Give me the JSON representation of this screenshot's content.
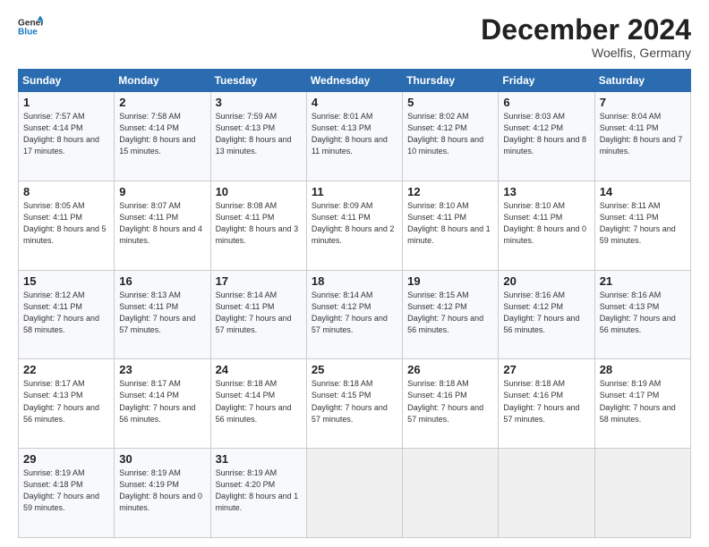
{
  "header": {
    "logo_line1": "General",
    "logo_line2": "Blue",
    "month_title": "December 2024",
    "location": "Woelfis, Germany"
  },
  "days_of_week": [
    "Sunday",
    "Monday",
    "Tuesday",
    "Wednesday",
    "Thursday",
    "Friday",
    "Saturday"
  ],
  "weeks": [
    [
      {
        "num": "1",
        "rise": "7:57 AM",
        "set": "4:14 PM",
        "daylight": "8 hours and 17 minutes."
      },
      {
        "num": "2",
        "rise": "7:58 AM",
        "set": "4:14 PM",
        "daylight": "8 hours and 15 minutes."
      },
      {
        "num": "3",
        "rise": "7:59 AM",
        "set": "4:13 PM",
        "daylight": "8 hours and 13 minutes."
      },
      {
        "num": "4",
        "rise": "8:01 AM",
        "set": "4:13 PM",
        "daylight": "8 hours and 11 minutes."
      },
      {
        "num": "5",
        "rise": "8:02 AM",
        "set": "4:12 PM",
        "daylight": "8 hours and 10 minutes."
      },
      {
        "num": "6",
        "rise": "8:03 AM",
        "set": "4:12 PM",
        "daylight": "8 hours and 8 minutes."
      },
      {
        "num": "7",
        "rise": "8:04 AM",
        "set": "4:11 PM",
        "daylight": "8 hours and 7 minutes."
      }
    ],
    [
      {
        "num": "8",
        "rise": "8:05 AM",
        "set": "4:11 PM",
        "daylight": "8 hours and 5 minutes."
      },
      {
        "num": "9",
        "rise": "8:07 AM",
        "set": "4:11 PM",
        "daylight": "8 hours and 4 minutes."
      },
      {
        "num": "10",
        "rise": "8:08 AM",
        "set": "4:11 PM",
        "daylight": "8 hours and 3 minutes."
      },
      {
        "num": "11",
        "rise": "8:09 AM",
        "set": "4:11 PM",
        "daylight": "8 hours and 2 minutes."
      },
      {
        "num": "12",
        "rise": "8:10 AM",
        "set": "4:11 PM",
        "daylight": "8 hours and 1 minute."
      },
      {
        "num": "13",
        "rise": "8:10 AM",
        "set": "4:11 PM",
        "daylight": "8 hours and 0 minutes."
      },
      {
        "num": "14",
        "rise": "8:11 AM",
        "set": "4:11 PM",
        "daylight": "7 hours and 59 minutes."
      }
    ],
    [
      {
        "num": "15",
        "rise": "8:12 AM",
        "set": "4:11 PM",
        "daylight": "7 hours and 58 minutes."
      },
      {
        "num": "16",
        "rise": "8:13 AM",
        "set": "4:11 PM",
        "daylight": "7 hours and 57 minutes."
      },
      {
        "num": "17",
        "rise": "8:14 AM",
        "set": "4:11 PM",
        "daylight": "7 hours and 57 minutes."
      },
      {
        "num": "18",
        "rise": "8:14 AM",
        "set": "4:12 PM",
        "daylight": "7 hours and 57 minutes."
      },
      {
        "num": "19",
        "rise": "8:15 AM",
        "set": "4:12 PM",
        "daylight": "7 hours and 56 minutes."
      },
      {
        "num": "20",
        "rise": "8:16 AM",
        "set": "4:12 PM",
        "daylight": "7 hours and 56 minutes."
      },
      {
        "num": "21",
        "rise": "8:16 AM",
        "set": "4:13 PM",
        "daylight": "7 hours and 56 minutes."
      }
    ],
    [
      {
        "num": "22",
        "rise": "8:17 AM",
        "set": "4:13 PM",
        "daylight": "7 hours and 56 minutes."
      },
      {
        "num": "23",
        "rise": "8:17 AM",
        "set": "4:14 PM",
        "daylight": "7 hours and 56 minutes."
      },
      {
        "num": "24",
        "rise": "8:18 AM",
        "set": "4:14 PM",
        "daylight": "7 hours and 56 minutes."
      },
      {
        "num": "25",
        "rise": "8:18 AM",
        "set": "4:15 PM",
        "daylight": "7 hours and 57 minutes."
      },
      {
        "num": "26",
        "rise": "8:18 AM",
        "set": "4:16 PM",
        "daylight": "7 hours and 57 minutes."
      },
      {
        "num": "27",
        "rise": "8:18 AM",
        "set": "4:16 PM",
        "daylight": "7 hours and 57 minutes."
      },
      {
        "num": "28",
        "rise": "8:19 AM",
        "set": "4:17 PM",
        "daylight": "7 hours and 58 minutes."
      }
    ],
    [
      {
        "num": "29",
        "rise": "8:19 AM",
        "set": "4:18 PM",
        "daylight": "7 hours and 59 minutes."
      },
      {
        "num": "30",
        "rise": "8:19 AM",
        "set": "4:19 PM",
        "daylight": "8 hours and 0 minutes."
      },
      {
        "num": "31",
        "rise": "8:19 AM",
        "set": "4:20 PM",
        "daylight": "8 hours and 1 minute."
      },
      null,
      null,
      null,
      null
    ]
  ],
  "labels": {
    "sunrise": "Sunrise:",
    "sunset": "Sunset:",
    "daylight": "Daylight:"
  }
}
